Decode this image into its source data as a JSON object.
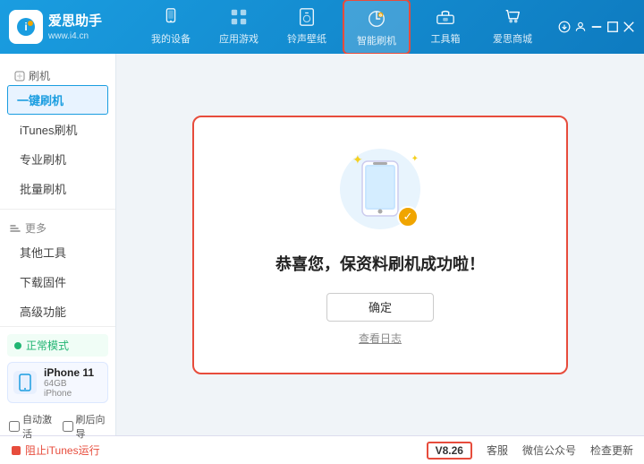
{
  "header": {
    "logo_letter": "i",
    "brand_name": "爱思助手",
    "brand_url": "www.i4.cn",
    "nav_tabs": [
      {
        "id": "my-device",
        "label": "我的设备",
        "icon": "device"
      },
      {
        "id": "apps-games",
        "label": "应用游戏",
        "icon": "apps"
      },
      {
        "id": "ringtones",
        "label": "铃声壁纸",
        "icon": "ringtones"
      },
      {
        "id": "smart-flash",
        "label": "智能刷机",
        "icon": "flash",
        "active": true
      },
      {
        "id": "toolbox",
        "label": "工具箱",
        "icon": "tools"
      },
      {
        "id": "store",
        "label": "爱思商城",
        "icon": "store"
      }
    ]
  },
  "sidebar": {
    "section_label": "刷机",
    "items": [
      {
        "id": "one-click-flash",
        "label": "一键刷机",
        "active": true
      },
      {
        "id": "itunes-flash",
        "label": "iTunes刷机"
      },
      {
        "id": "pro-flash",
        "label": "专业刷机"
      },
      {
        "id": "batch-flash",
        "label": "批量刷机"
      }
    ],
    "more_label": "更多",
    "more_items": [
      {
        "id": "other-tools",
        "label": "其他工具"
      },
      {
        "id": "download-firmware",
        "label": "下载固件"
      },
      {
        "id": "advanced",
        "label": "高级功能"
      }
    ]
  },
  "device": {
    "mode_label": "正常模式",
    "name": "iPhone 11",
    "storage": "64GB",
    "model": "iPhone"
  },
  "checkboxes": [
    {
      "id": "auto-activate",
      "label": "自动激活",
      "checked": false
    },
    {
      "id": "guide",
      "label": "刷后向导",
      "checked": false
    }
  ],
  "result": {
    "success_text": "恭喜您，保资料刷机成功啦！",
    "confirm_label": "确定",
    "view_log_label": "查看日志"
  },
  "bottom_bar": {
    "stop_itunes_label": "阻止iTunes运行",
    "version": "V8.26",
    "customer_service": "客服",
    "wechat_label": "微信公众号",
    "check_update": "检查更新"
  }
}
